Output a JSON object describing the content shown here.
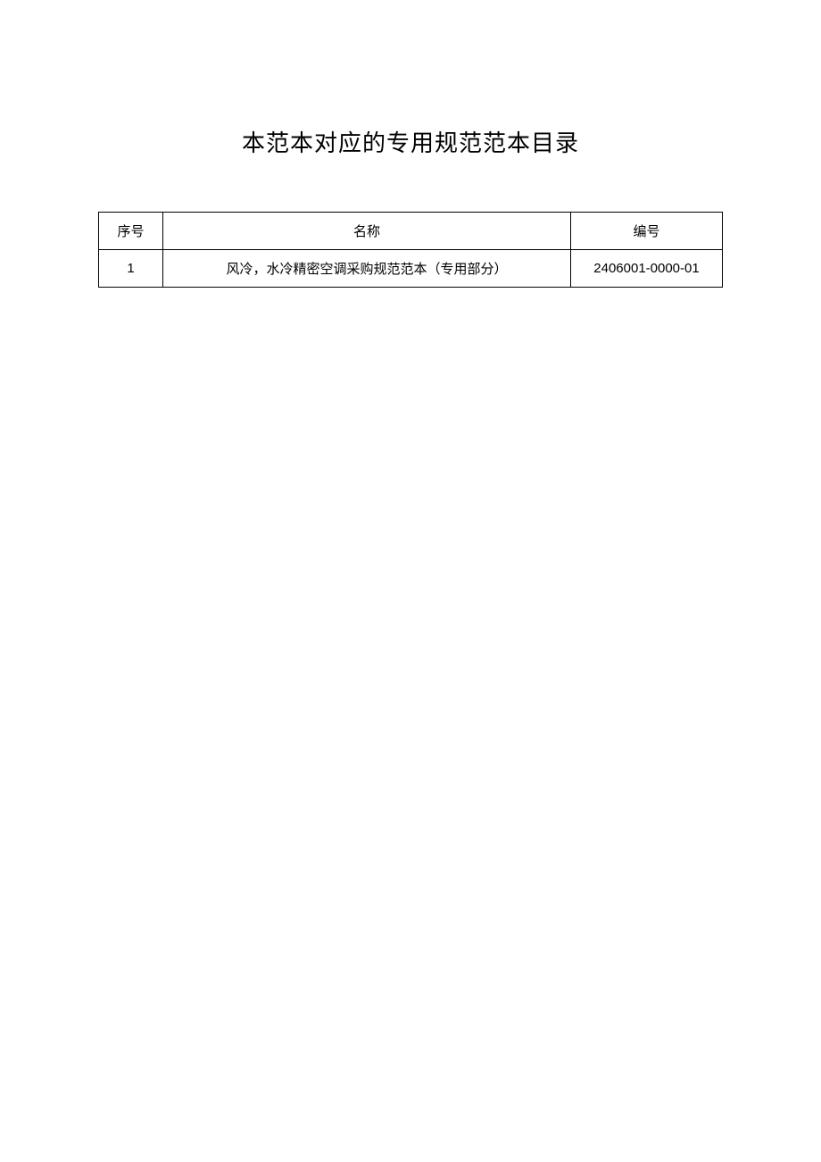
{
  "title": "本范本对应的专用规范范本目录",
  "table": {
    "headers": {
      "index": "序号",
      "name": "名称",
      "code": "编号"
    },
    "rows": [
      {
        "index": "1",
        "name": "风冷，水冷精密空调采购规范范本（专用部分）",
        "code": "2406001-0000-01"
      }
    ]
  }
}
